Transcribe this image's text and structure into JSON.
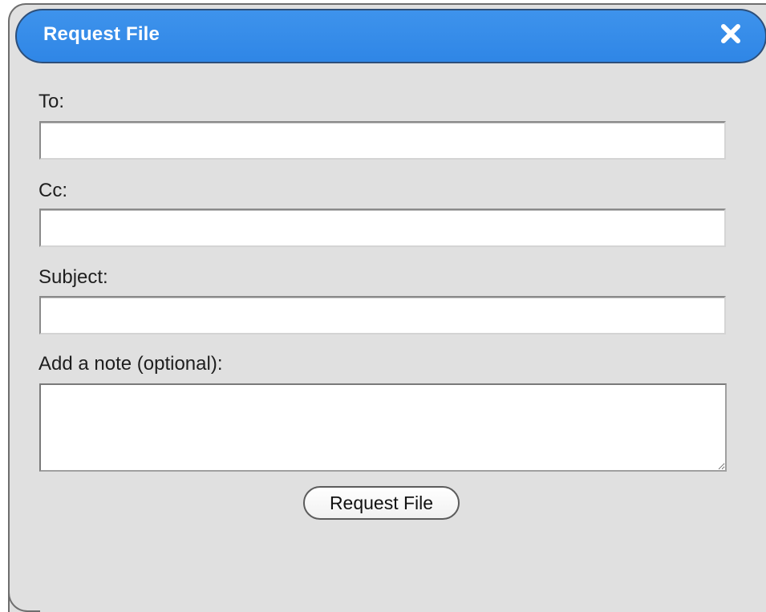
{
  "dialog": {
    "title": "Request File",
    "close_icon": "close-icon",
    "accent_color": "#3a8ee9"
  },
  "form": {
    "to_label": "To:",
    "to_value": "",
    "cc_label": "Cc:",
    "cc_value": "",
    "subject_label": "Subject:",
    "subject_value": "",
    "note_label": "Add a note (optional):",
    "note_value": ""
  },
  "actions": {
    "submit_label": "Request File"
  }
}
